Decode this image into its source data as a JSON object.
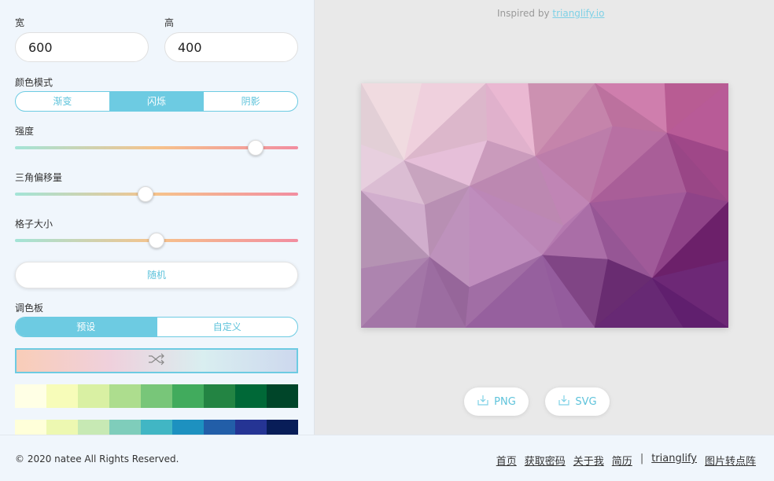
{
  "sidebar": {
    "width_label": "宽",
    "width_value": "600",
    "height_label": "高",
    "height_value": "400",
    "color_mode_label": "颜色模式",
    "color_modes": [
      "渐变",
      "闪烁",
      "阴影"
    ],
    "color_mode_selected": "闪烁",
    "intensity_label": "强度",
    "intensity_value": 0.85,
    "offset_label": "三角偏移量",
    "offset_value": 0.46,
    "cell_size_label": "格子大小",
    "cell_size_value": 0.5,
    "random_label": "随机",
    "palette_label": "调色板",
    "palette_tabs": [
      "预设",
      "自定义"
    ],
    "palette_tab_selected": "预设",
    "palette_rows": [
      [
        "#ffffe5",
        "#f7fcb9",
        "#d9f0a3",
        "#addd8e",
        "#78c679",
        "#41ab5d",
        "#238443",
        "#006837",
        "#004529"
      ],
      [
        "#ffffd9",
        "#edf8b1",
        "#c7e9b4",
        "#7fcdbb",
        "#41b6c4",
        "#1d91c0",
        "#225ea8",
        "#253494",
        "#081d58"
      ]
    ]
  },
  "main": {
    "inspired_prefix": "Inspired by ",
    "inspired_link": "trianglify.io",
    "download_png": "PNG",
    "download_svg": "SVG"
  },
  "footer": {
    "copyright": "© 2020 natee All Rights Reserved.",
    "links": [
      "首页",
      "获取密码",
      "关于我",
      "简历",
      "trianglify",
      "图片转点阵"
    ],
    "separator": "|"
  },
  "icons": {
    "shuffle": "shuffle-icon",
    "download": "download-icon"
  }
}
